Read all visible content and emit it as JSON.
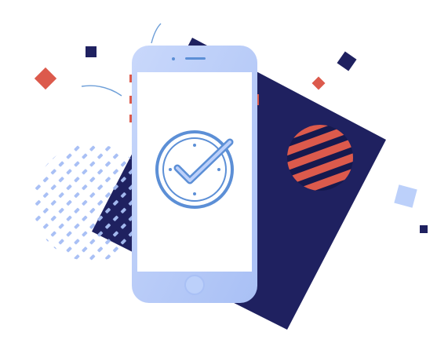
{
  "illustration": {
    "subject": "smartphone-with-check-clock",
    "icons": {
      "phone": "smartphone-icon",
      "status": "check-clock-icon",
      "speaker": "speaker-icon",
      "home": "home-button-icon"
    },
    "colors": {
      "navy": "#1f2160",
      "navy_deep": "#16194e",
      "coral": "#dc5a4c",
      "light_blue": "#a9c0f5",
      "pale_blue": "#bcd0fa",
      "phone_body": "#b7cbf8",
      "screen": "#ffffff",
      "line": "#5c8fd6",
      "arc_line": "#6e9fd8"
    }
  }
}
